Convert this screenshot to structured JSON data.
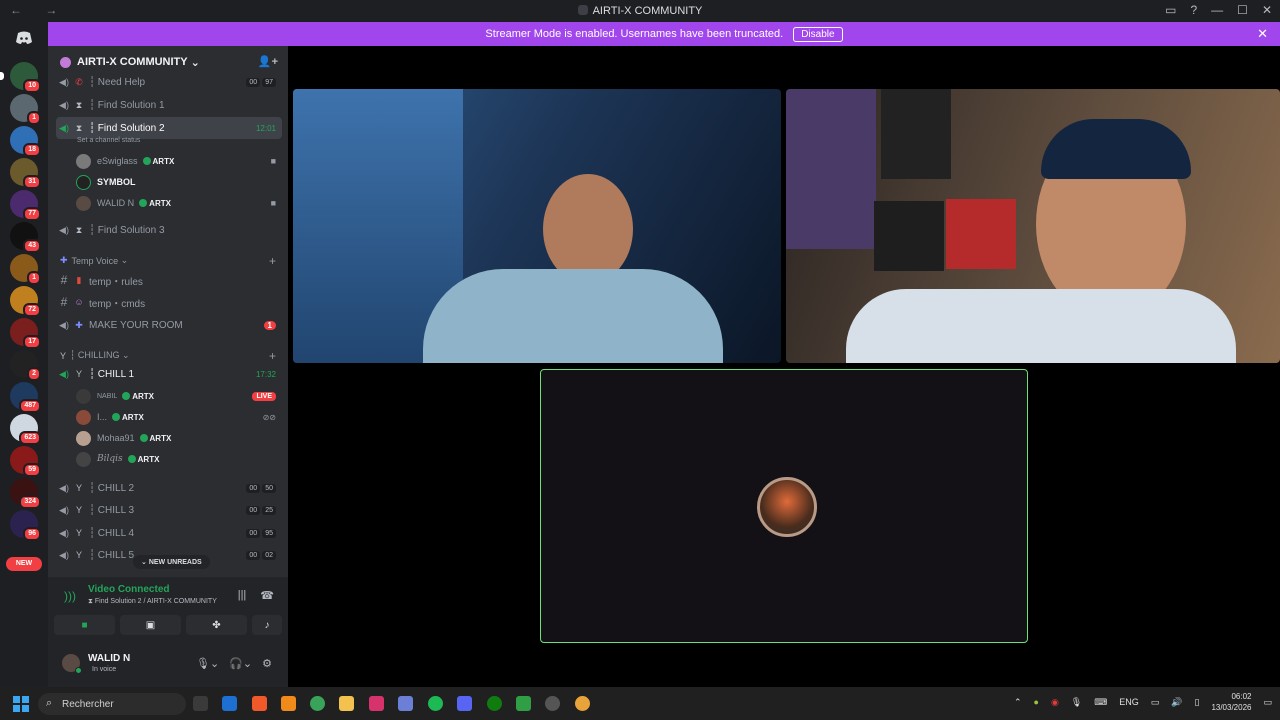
{
  "window": {
    "title": "AIRTI-X COMMUNITY",
    "nav": "←  →"
  },
  "banner": {
    "text": "Streamer Mode is enabled. Usernames have been truncated.",
    "button": "Disable"
  },
  "servers": {
    "counts": [
      "10",
      "1",
      "18",
      "31",
      "77",
      "43",
      "1",
      "72",
      "17",
      "2",
      "487",
      "623",
      "59",
      "324",
      "96"
    ],
    "new_label": "NEW"
  },
  "server_name": "AIRTI-X COMMUNITY",
  "channels": {
    "need_help": {
      "name": "┆ Need Help",
      "badge": [
        "00",
        "97"
      ]
    },
    "find1": {
      "name": "┆ Find Solution 1"
    },
    "find2": {
      "name": "┆ Find Solution 2",
      "timer": "12:01",
      "status": "Set a channel status"
    },
    "find2_users": [
      {
        "name": "eSwiglass",
        "tag": "ARTX"
      },
      {
        "name": "SYMBOL",
        "tag": ""
      },
      {
        "name": "WALID N",
        "tag": "ARTX"
      }
    ],
    "find3": {
      "name": "┆ Find Solution 3"
    },
    "temp_cat": "Temp Voice",
    "temp_rules": "temp・rules",
    "temp_cmds": "temp・cmds",
    "make_room": {
      "name": "MAKE YOUR ROOM",
      "badge": "1"
    },
    "chilling_cat": "┆ CHILLING",
    "chill1": {
      "name": "┆ CHILL 1",
      "timer": "17:32"
    },
    "chill1_users": [
      {
        "name": "NABIL",
        "tag": "ARTX",
        "live": "LIVE"
      },
      {
        "name": "I...",
        "tag": "ARTX"
      },
      {
        "name": "Mohaa91",
        "tag": "ARTX"
      },
      {
        "name": "Bilqis",
        "tag": "ARTX"
      }
    ],
    "chill2": {
      "name": "┆ CHILL 2",
      "badge": [
        "00",
        "50"
      ]
    },
    "chill3": {
      "name": "┆ CHILL 3",
      "badge": [
        "00",
        "25"
      ]
    },
    "chill4": {
      "name": "┆ CHILL 4",
      "badge": [
        "00",
        "95"
      ]
    },
    "chill5": {
      "name": "┆ CHILL 5",
      "badge": [
        "00",
        "02"
      ]
    },
    "new_unreads": "NEW UNREADS"
  },
  "voice": {
    "status": "Video Connected",
    "location": "Find Solution 2 / AIRTI-X COMMUNITY"
  },
  "user": {
    "name": "WALID N",
    "status": "In voice"
  },
  "taskbar": {
    "search": "Rechercher",
    "lang": "ENG",
    "time": "06:02",
    "date": "13/03/2026"
  },
  "colors": {
    "accent": "#a046ec",
    "green": "#23a559",
    "red": "#f23f43"
  }
}
